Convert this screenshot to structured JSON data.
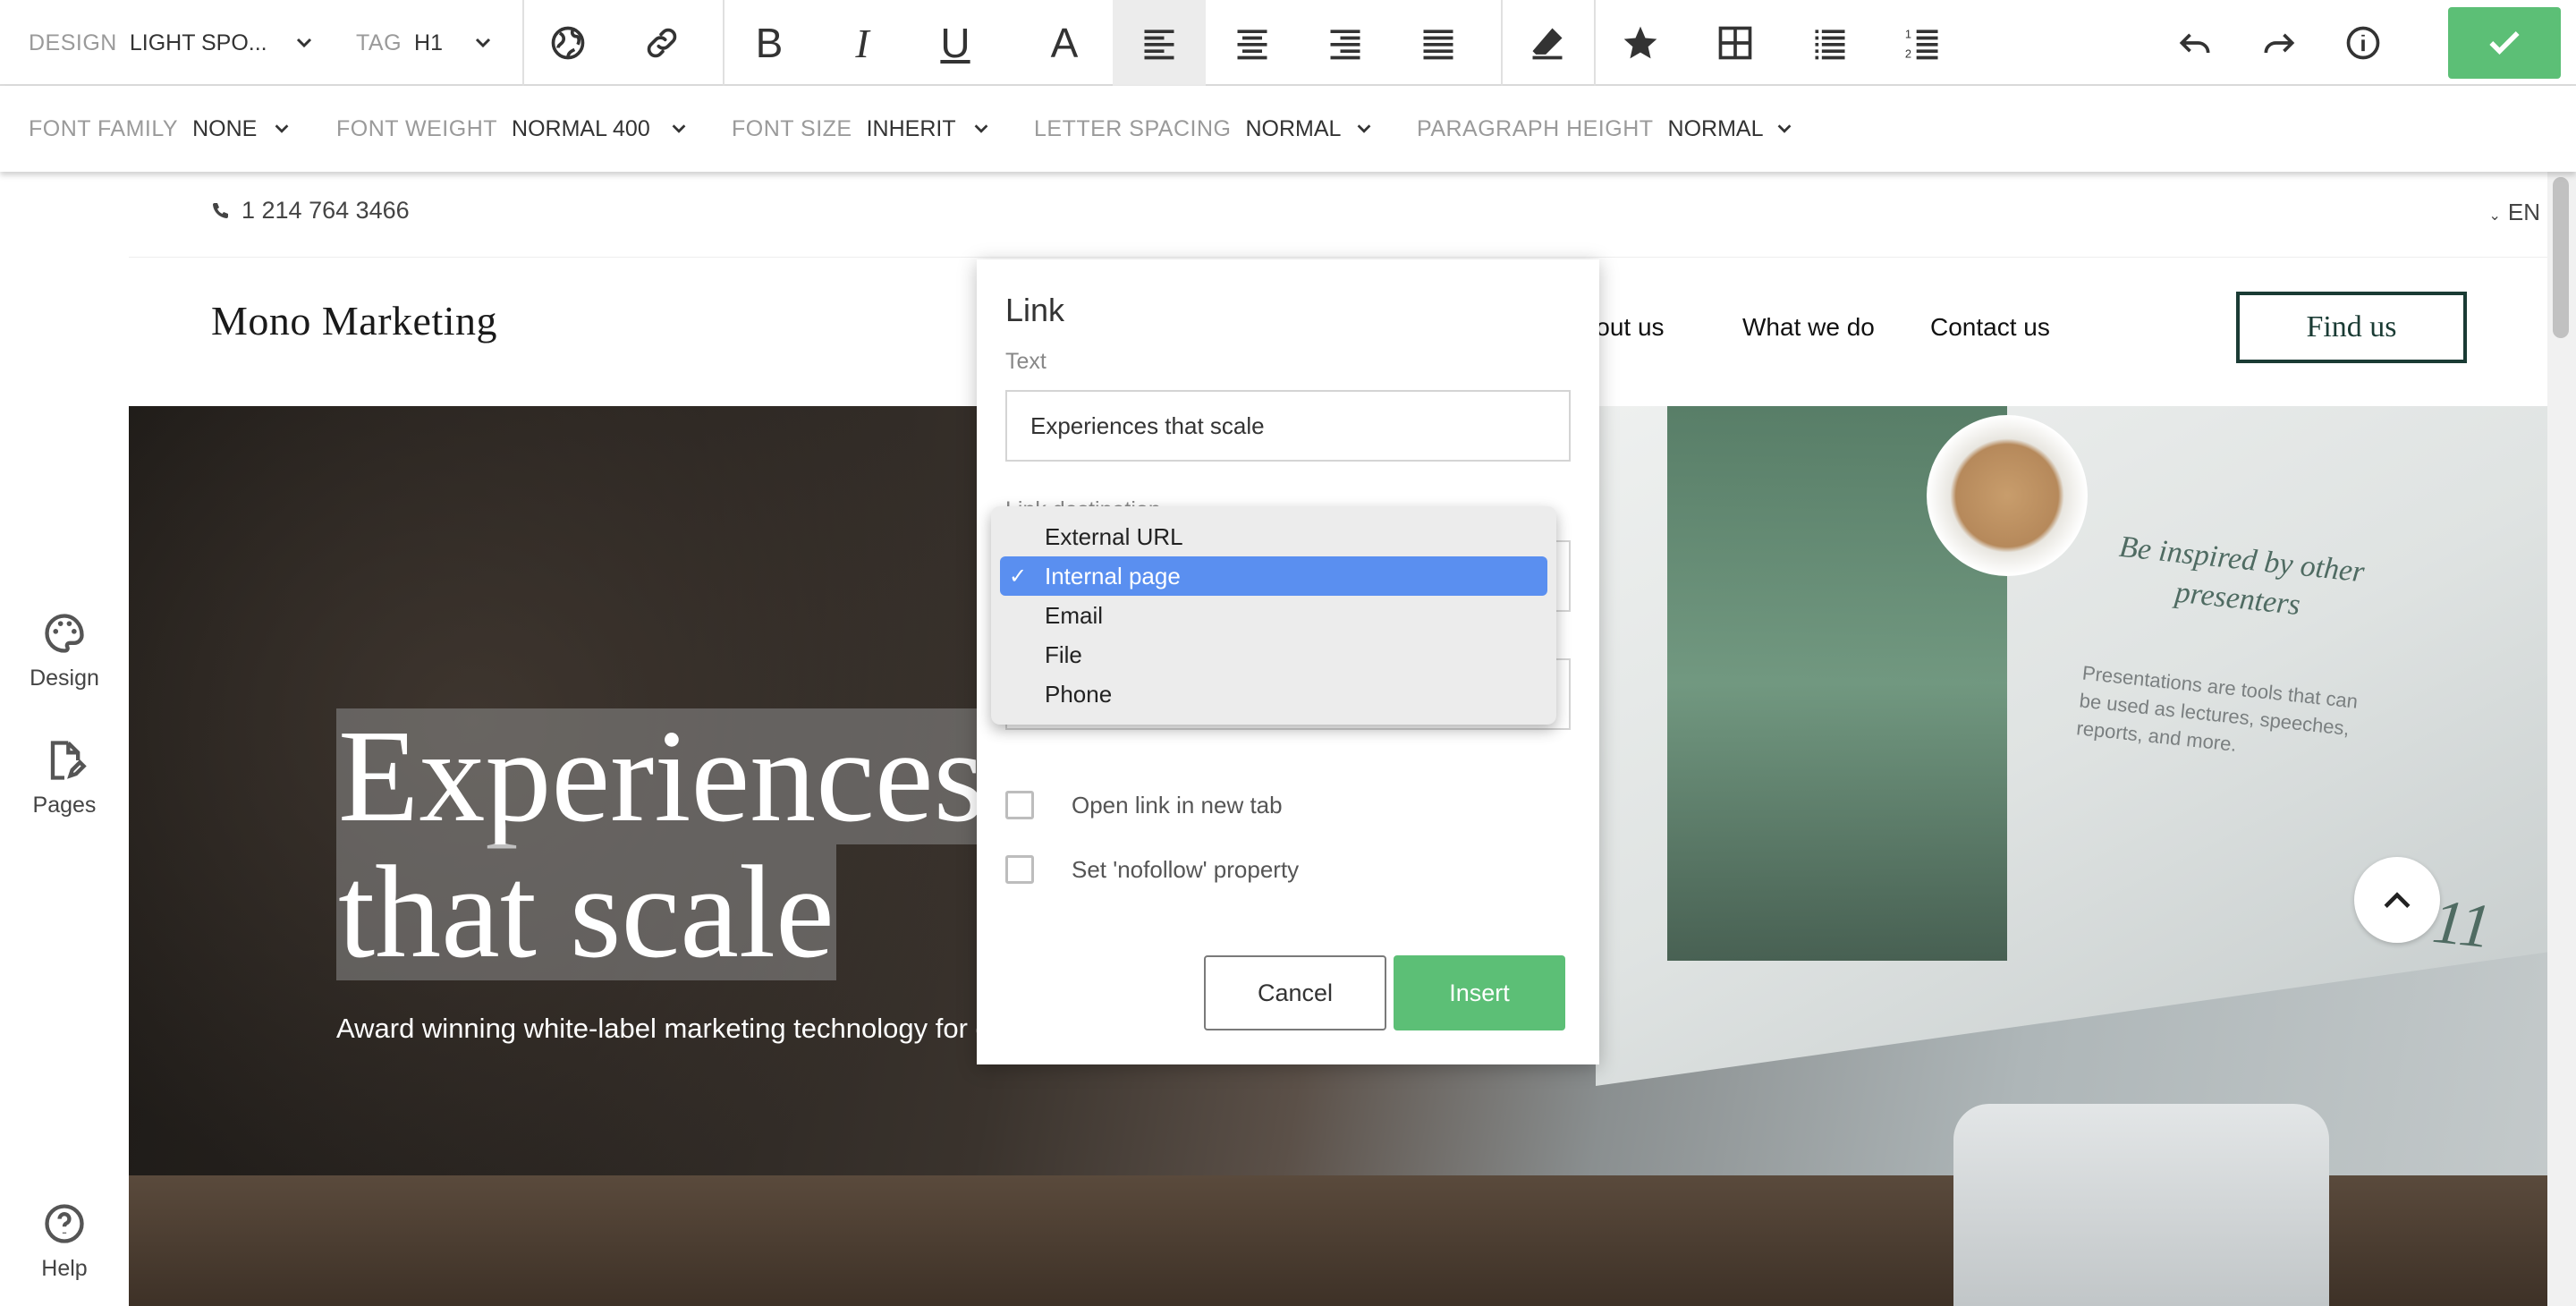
{
  "toolbar": {
    "design_label": "DESIGN",
    "design_value": "LIGHT SPO...",
    "tag_label": "TAG",
    "tag_value": "H1",
    "bold_glyph": "B",
    "italic_glyph": "I",
    "underline_glyph": "U",
    "color_glyph": "A"
  },
  "toolbar2": {
    "font_family_label": "FONT FAMILY",
    "font_family_value": "NONE",
    "font_weight_label": "FONT WEIGHT",
    "font_weight_value": "NORMAL 400",
    "font_size_label": "FONT SIZE",
    "font_size_value": "INHERIT",
    "letter_spacing_label": "LETTER SPACING",
    "letter_spacing_value": "NORMAL",
    "paragraph_height_label": "PARAGRAPH HEIGHT",
    "paragraph_height_value": "NORMAL"
  },
  "sidebar": {
    "items": [
      {
        "label": "Design",
        "icon": "palette-icon"
      },
      {
        "label": "Pages",
        "icon": "page-edit-icon"
      },
      {
        "label": "Help",
        "icon": "help-icon"
      }
    ]
  },
  "site": {
    "phone": "1 214 764 3466",
    "lang": "EN",
    "logo": "Mono Marketing",
    "nav": [
      "About us",
      "What we do",
      "Contact us"
    ],
    "find_us": "Find us",
    "headline_line1": "Experiences",
    "headline_line2": "that scale",
    "subline": "Award winning white-label marketing technology for digital",
    "inspired_title": "Be inspired by other presenters",
    "inspired_body": "Presentations are tools that can be used as lectures, speeches, reports, and more.",
    "page_number": "11"
  },
  "modal": {
    "title": "Link",
    "text_label": "Text",
    "text_value": "Experiences that scale",
    "destination_label": "Link destination",
    "dropdown_options": [
      "External URL",
      "Internal page",
      "Email",
      "File",
      "Phone"
    ],
    "selected_option": "Internal page",
    "new_tab_label": "Open link in new tab",
    "nofollow_label": "Set 'nofollow' property",
    "cancel_label": "Cancel",
    "insert_label": "Insert"
  },
  "colors": {
    "accent_green": "#5cbf76",
    "select_blue": "#5a8ff0",
    "find_us_border": "#1a3b34"
  }
}
